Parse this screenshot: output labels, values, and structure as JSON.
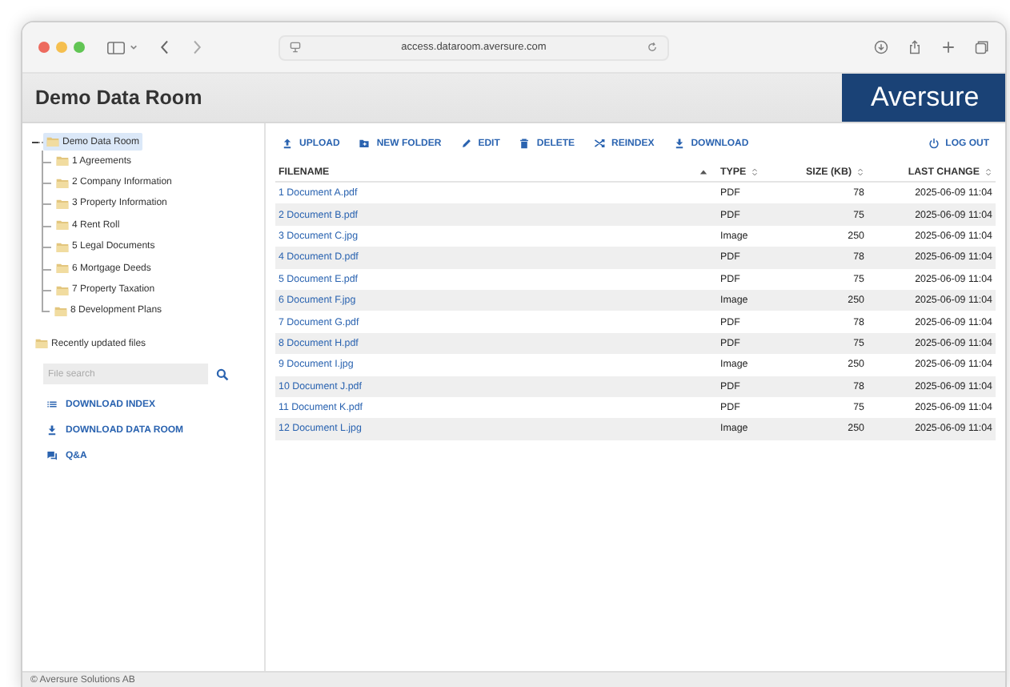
{
  "browser": {
    "url": "access.dataroom.aversure.com"
  },
  "header": {
    "title": "Demo Data Room",
    "logo": "Aversure"
  },
  "tree": {
    "label": "Demo Data Room",
    "selected": true,
    "expanded": true,
    "children": [
      {
        "label": "1 Agreements",
        "selected": false
      },
      {
        "label": "2 Company Information",
        "selected": false
      },
      {
        "label": "3 Property Information",
        "selected": false
      },
      {
        "label": "4 Rent Roll",
        "selected": false
      },
      {
        "label": "5 Legal Documents",
        "selected": false
      },
      {
        "label": "6 Mortgage Deeds",
        "selected": false
      },
      {
        "label": "7 Property Taxation",
        "selected": false
      },
      {
        "label": "8 Development Plans",
        "selected": false
      }
    ]
  },
  "recent": {
    "label": "Recently updated files"
  },
  "search": {
    "placeholder": "File search"
  },
  "sidebar_links": [
    {
      "kind": "list",
      "label": "DOWNLOAD INDEX"
    },
    {
      "kind": "download",
      "label": "DOWNLOAD DATA ROOM"
    },
    {
      "kind": "chat",
      "label": "Q&A"
    }
  ],
  "toolbar": [
    {
      "kind": "upload",
      "label": "UPLOAD"
    },
    {
      "kind": "folder",
      "label": "NEW FOLDER"
    },
    {
      "kind": "edit",
      "label": "EDIT"
    },
    {
      "kind": "delete",
      "label": "DELETE"
    },
    {
      "kind": "reindex",
      "label": "REINDEX"
    },
    {
      "kind": "download",
      "label": "DOWNLOAD"
    }
  ],
  "logout": {
    "label": "LOG OUT"
  },
  "table": {
    "columns": [
      {
        "label": "FILENAME",
        "sorted": true
      },
      {
        "label": "TYPE",
        "sorted": false
      },
      {
        "label": "SIZE (KB)",
        "sorted": false
      },
      {
        "label": "LAST CHANGE",
        "sorted": false
      }
    ],
    "rows": [
      [
        "1 Document A.pdf",
        "PDF",
        "78",
        "2025-06-09 11:04"
      ],
      [
        "2 Document B.pdf",
        "PDF",
        "75",
        "2025-06-09 11:04"
      ],
      [
        "3 Document C.jpg",
        "Image",
        "250",
        "2025-06-09 11:04"
      ],
      [
        "4 Document D.pdf",
        "PDF",
        "78",
        "2025-06-09 11:04"
      ],
      [
        "5 Document E.pdf",
        "PDF",
        "75",
        "2025-06-09 11:04"
      ],
      [
        "6 Document F.jpg",
        "Image",
        "250",
        "2025-06-09 11:04"
      ],
      [
        "7 Document G.pdf",
        "PDF",
        "78",
        "2025-06-09 11:04"
      ],
      [
        "8 Document H.pdf",
        "PDF",
        "75",
        "2025-06-09 11:04"
      ],
      [
        "9 Document I.jpg",
        "Image",
        "250",
        "2025-06-09 11:04"
      ],
      [
        "10 Document J.pdf",
        "PDF",
        "78",
        "2025-06-09 11:04"
      ],
      [
        "11 Document K.pdf",
        "PDF",
        "75",
        "2025-06-09 11:04"
      ],
      [
        "12 Document L.jpg",
        "Image",
        "250",
        "2025-06-09 11:04"
      ]
    ]
  },
  "footer": "© Aversure Solutions AB"
}
